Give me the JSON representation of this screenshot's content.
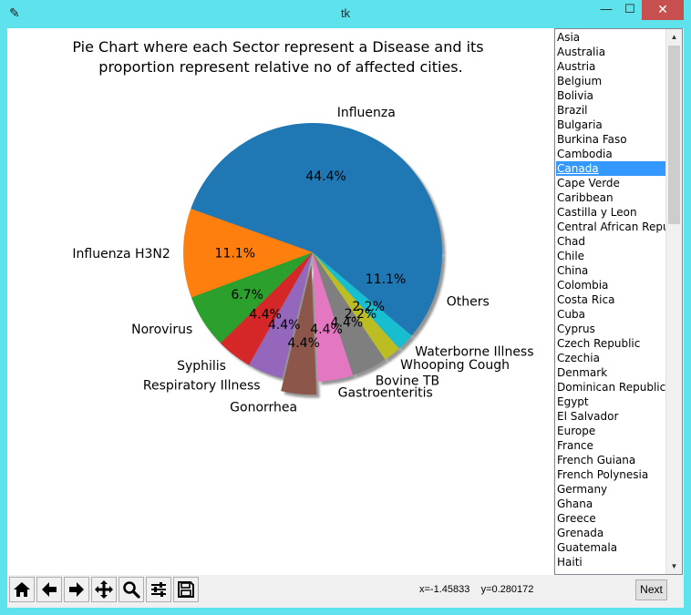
{
  "window": {
    "title": "tk",
    "min_glyph": "—",
    "max_glyph": "☐",
    "close_glyph": "✕",
    "icon": "feather-icon"
  },
  "chart_data": {
    "type": "pie",
    "title_lines": [
      "Pie Chart where each Sector represent a Disease and its",
      "proportion represent relative no of affected cities."
    ],
    "slices": [
      {
        "label": "Influenza",
        "value": 44.4,
        "pct": "44.4%",
        "color": "#1f77b4",
        "explode": false
      },
      {
        "label": "Influenza H3N2",
        "value": 11.1,
        "pct": "11.1%",
        "color": "#ff7f0e",
        "explode": false
      },
      {
        "label": "Norovirus",
        "value": 6.7,
        "pct": "6.7%",
        "color": "#2ca02c",
        "explode": false
      },
      {
        "label": "Syphilis",
        "value": 4.4,
        "pct": "4.4%",
        "color": "#d62728",
        "explode": false
      },
      {
        "label": "Respiratory Illness",
        "value": 4.4,
        "pct": "4.4%",
        "color": "#9467bd",
        "explode": false
      },
      {
        "label": "Gonorrhea",
        "value": 4.4,
        "pct": "4.4%",
        "color": "#8c564b",
        "explode": true
      },
      {
        "label": "Gastroenteritis",
        "value": 4.4,
        "pct": "4.4%",
        "color": "#e377c2",
        "explode": false
      },
      {
        "label": "Bovine TB",
        "value": 4.4,
        "pct": "4.4%",
        "color": "#7f7f7f",
        "explode": false
      },
      {
        "label": "Whooping Cough",
        "value": 2.2,
        "pct": "2.2%",
        "color": "#bcbd22",
        "explode": false
      },
      {
        "label": "Waterborne Illness",
        "value": 2.2,
        "pct": "2.2%",
        "color": "#17becf",
        "explode": false
      },
      {
        "label": "Others",
        "value": 11.1,
        "pct": "11.1%",
        "color": "#1f77b4",
        "explode": false
      }
    ],
    "shadow": true
  },
  "country_list": {
    "items": [
      "Asia",
      "Australia",
      "Austria",
      "Belgium",
      "Bolivia",
      "Brazil",
      "Bulgaria",
      "Burkina Faso",
      "Cambodia",
      "Canada",
      "Cape Verde",
      "Caribbean",
      "Castilla y Leon",
      "Central African Republ",
      "Chad",
      "Chile",
      "China",
      "Colombia",
      "Costa Rica",
      "Cuba",
      "Cyprus",
      "Czech Republic",
      "Czechia",
      "Denmark",
      "Dominican Republic",
      "Egypt",
      "El Salvador",
      "Europe",
      "France",
      "French Guiana",
      "French Polynesia",
      "Germany",
      "Ghana",
      "Greece",
      "Grenada",
      "Guatemala",
      "Haiti"
    ],
    "selected": "Canada"
  },
  "toolbar": {
    "buttons": [
      {
        "name": "home-icon"
      },
      {
        "name": "back-arrow-icon"
      },
      {
        "name": "forward-arrow-icon"
      },
      {
        "name": "pan-icon"
      },
      {
        "name": "zoom-icon"
      },
      {
        "name": "configure-subplots-icon"
      },
      {
        "name": "save-icon"
      }
    ],
    "coords_text": "x=-1.45833    y=0.280172",
    "next_label": "Next"
  }
}
